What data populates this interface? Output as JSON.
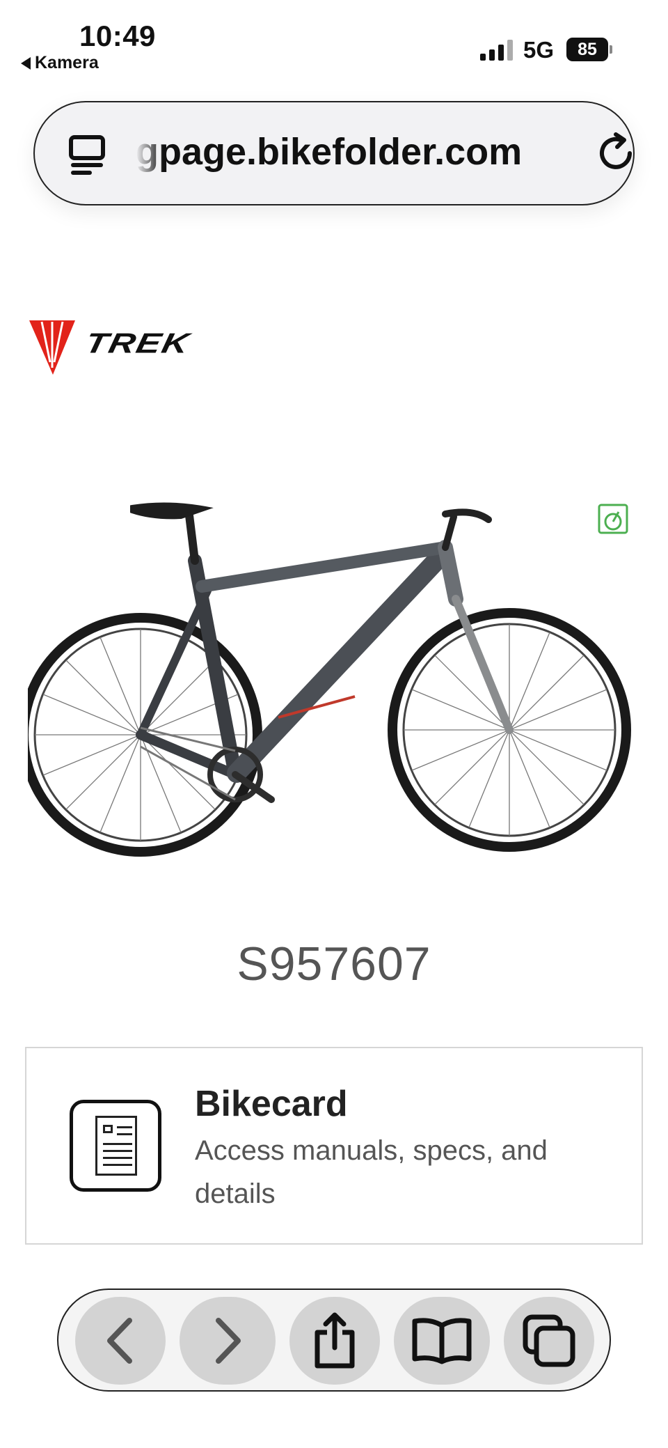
{
  "status_bar": {
    "time": "10:49",
    "back_label": "Kamera",
    "network": "5G",
    "battery": "85"
  },
  "url_bar": {
    "url": "gpage.bikefolder.com",
    "reader_icon": "reader-mode-icon",
    "reload_icon": "reload-icon"
  },
  "page": {
    "brand": "TREK",
    "brand_color": "#e2231a",
    "serial": "S957607",
    "bikecard": {
      "title": "Bikecard",
      "description": "Access manuals, specs, and details",
      "icon": "document-icon"
    },
    "accent_green": "#4caf50"
  },
  "toolbar": {
    "buttons": [
      "back-icon",
      "forward-icon",
      "share-icon",
      "bookmarks-icon",
      "tabs-icon"
    ]
  }
}
